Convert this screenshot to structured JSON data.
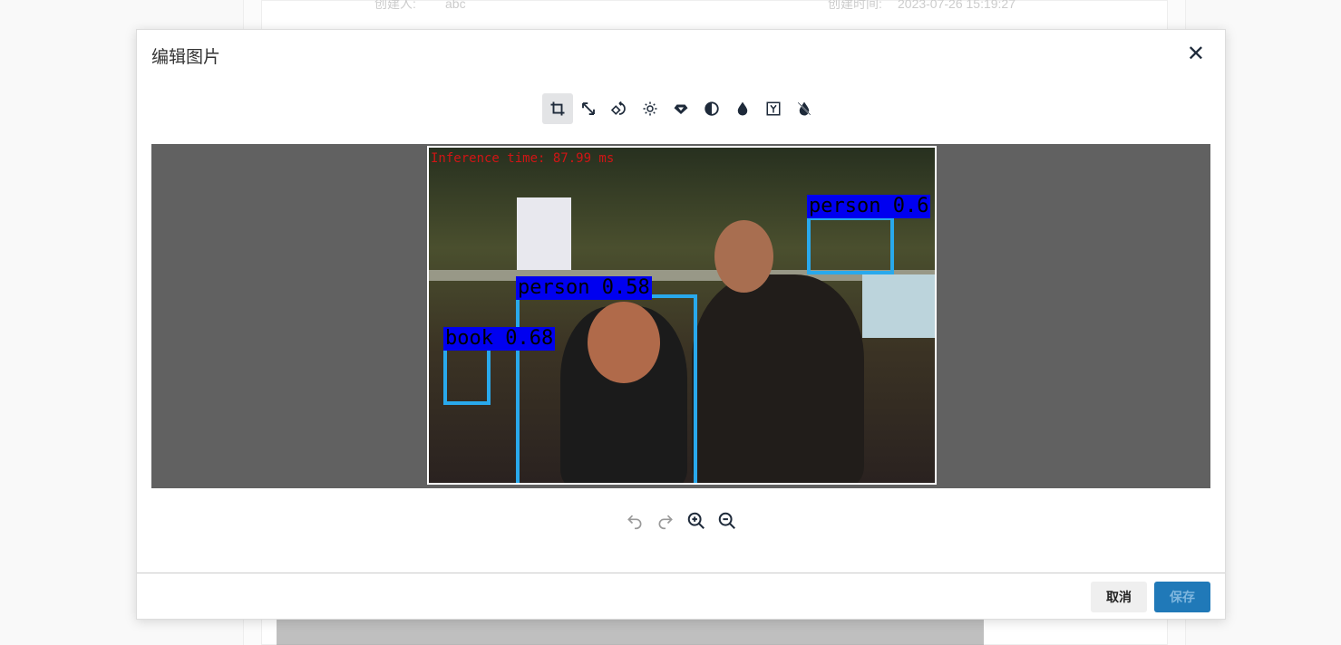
{
  "background": {
    "creator_label": "创建人:",
    "creator_value": "abc",
    "created_time_label": "创建时间:",
    "created_time_value": "2023-07-26 15:19:27"
  },
  "modal": {
    "title": "编辑图片",
    "close_icon": "close-icon",
    "toolbar": [
      {
        "name": "crop",
        "icon": "crop-icon",
        "active": true
      },
      {
        "name": "resize",
        "icon": "resize-icon"
      },
      {
        "name": "rotate",
        "icon": "rotate-icon"
      },
      {
        "name": "brightness",
        "icon": "sun-icon"
      },
      {
        "name": "saturation",
        "icon": "diamond-icon"
      },
      {
        "name": "contrast",
        "icon": "contrast-icon"
      },
      {
        "name": "hue",
        "icon": "drop-icon"
      },
      {
        "name": "gamma",
        "icon": "y-box-icon"
      },
      {
        "name": "desaturate",
        "icon": "drop-slash-icon"
      }
    ],
    "image_overlay": {
      "inference": "Inference time: 87.99 ms",
      "detections": [
        "person 0.6",
        "person 0.58",
        "book 0.68"
      ]
    },
    "bottom_tools": [
      "undo-icon",
      "redo-icon",
      "zoom-in-icon",
      "zoom-out-icon"
    ],
    "cancel_label": "取消",
    "save_label": "保存"
  }
}
